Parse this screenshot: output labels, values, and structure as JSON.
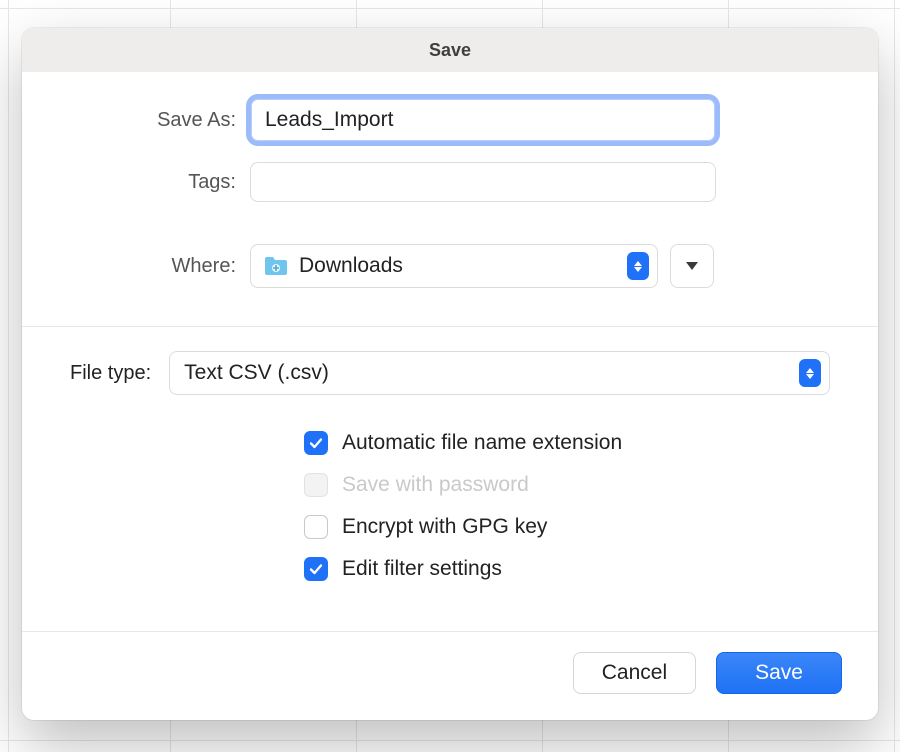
{
  "dialog": {
    "title": "Save",
    "save_as_label": "Save As:",
    "save_as_value": "Leads_Import",
    "tags_label": "Tags:",
    "tags_value": "",
    "where_label": "Where:",
    "where_value": "Downloads"
  },
  "filetype": {
    "label": "File type:",
    "value": "Text CSV (.csv)"
  },
  "checkboxes": {
    "auto_ext": {
      "label": "Automatic file name extension",
      "checked": true,
      "disabled": false
    },
    "password": {
      "label": "Save with password",
      "checked": false,
      "disabled": true
    },
    "gpg": {
      "label": "Encrypt with GPG key",
      "checked": false,
      "disabled": false
    },
    "filter": {
      "label": "Edit filter settings",
      "checked": true,
      "disabled": false
    }
  },
  "buttons": {
    "cancel": "Cancel",
    "save": "Save"
  }
}
